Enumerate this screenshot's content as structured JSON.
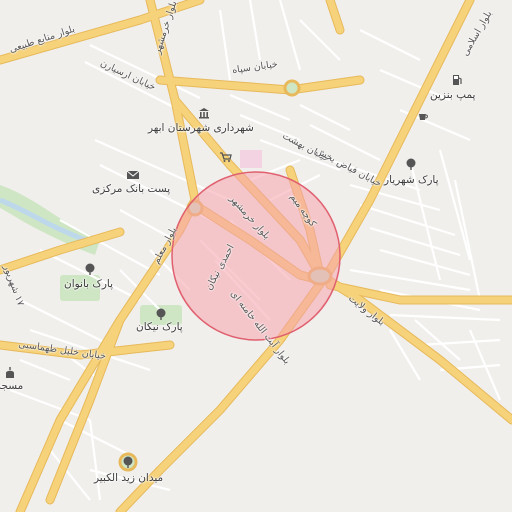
{
  "map": {
    "theme": {
      "background": "#f1efec",
      "road_major_fill": "#f6d27a",
      "road_major_casing": "#e7b95a",
      "road_minor": "#ffffff",
      "park": "#cfe6c4",
      "water": "#bcd8ea",
      "highlight_circle_fill": "#f5a3ad",
      "highlight_circle_stroke": "#e0606f"
    },
    "highlight_circle": {
      "label": ""
    },
    "road_labels": {
      "manabe_tabiei": "بلوار منابع طبیعی",
      "khorramshahr_top": "بلوار خرمشهر",
      "arshadian": "خیابان ارسیارن",
      "sepah": "خیابان سپاه",
      "bahesht": "خیابان بهشت",
      "fayyaz": "خیابان فیاض بخش",
      "khorramshahr_mid": "بلوار خرمشهر",
      "koocheh": "کوچه میم",
      "moallem": "بلوار معلم",
      "ahmadi": "احمدی نیکان",
      "velayat": "بلوار ولایت",
      "ayatollah": "بلوار آیت الله خامنه ای",
      "khalil": "خیابان خلیل طهماسبی",
      "eslami": "بلوار اسلامی",
      "hafdah": "۱۷ شهریور",
      "gharbi": "بلوار"
    },
    "pois": {
      "municipality": {
        "label": "شهرداری شهرستان ابهر",
        "icon": "municipality-icon"
      },
      "post_bank": {
        "label": "پست بانک مرکزی",
        "icon": "mail-icon"
      },
      "gas_station": {
        "label": "پمپ بنزین",
        "icon": "fuel-icon"
      },
      "park_shahriar": {
        "label": "پارک شهریار",
        "icon": "tree-icon"
      },
      "park_banovan": {
        "label": "پارک بانوان",
        "icon": "tree-icon"
      },
      "park_nikan": {
        "label": "پارک نیکان",
        "icon": "tree-icon"
      },
      "mosque": {
        "label": "مسجد",
        "icon": "mosque-icon"
      },
      "maydan": {
        "label": "میدان زید الکبیر",
        "icon": "landmark-icon"
      },
      "cart": {
        "label": "",
        "icon": "cart-icon"
      },
      "cafe": {
        "label": "",
        "icon": "cafe-icon"
      }
    }
  }
}
